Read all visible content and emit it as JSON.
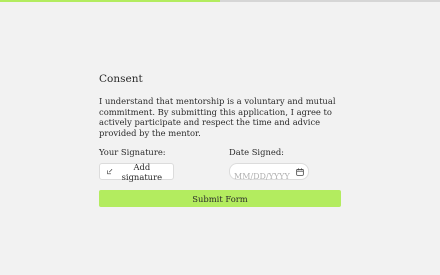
{
  "progress": {
    "percent": 50,
    "color": "#b3ec5f"
  },
  "consent": {
    "title": "Consent",
    "text": "I understand that mentorship is a voluntary and mutual commitment. By submitting this application, I agree to actively participate and respect the time and advice provided by the mentor."
  },
  "signature": {
    "label": "Your Signature:",
    "button_label": "Add signature",
    "icon": "edit-icon"
  },
  "date": {
    "label": "Date Signed:",
    "value": "",
    "placeholder": "MM/DD/YYYY",
    "icon": "calendar-icon"
  },
  "submit": {
    "label": "Submit Form"
  }
}
